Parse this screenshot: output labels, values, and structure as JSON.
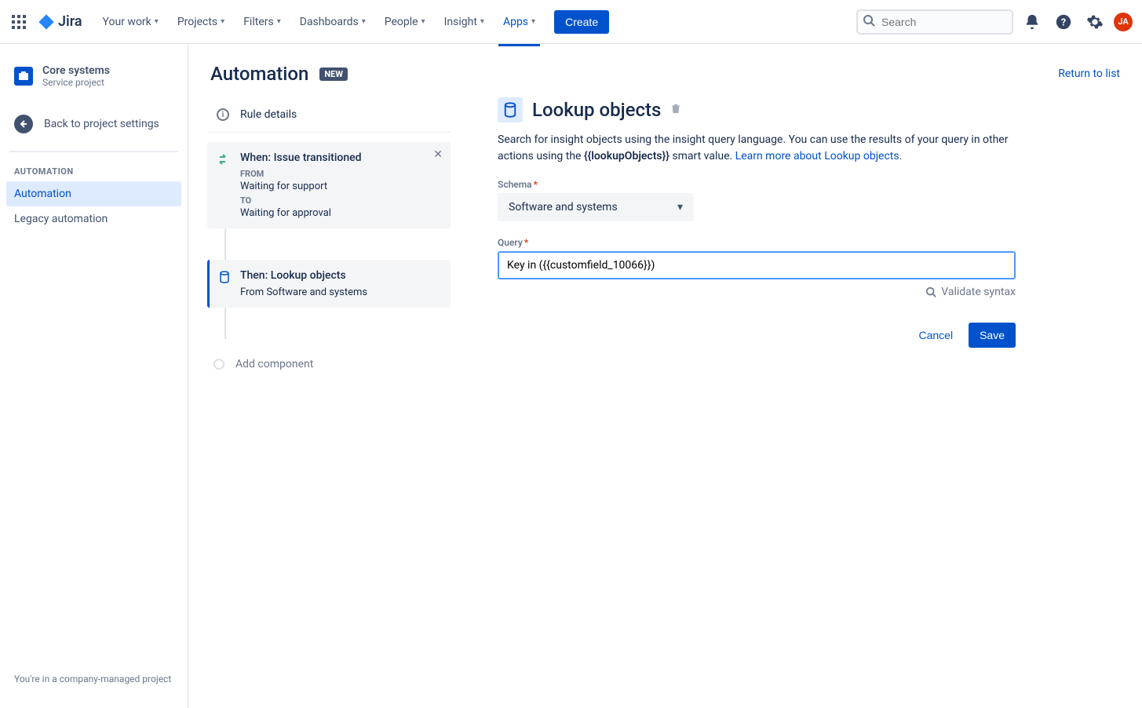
{
  "topbar": {
    "logo": "Jira",
    "nav": [
      "Your work",
      "Projects",
      "Filters",
      "Dashboards",
      "People",
      "Insight",
      "Apps"
    ],
    "active_nav": "Apps",
    "create": "Create",
    "search_placeholder": "Search",
    "avatar_initials": "JA"
  },
  "sidebar": {
    "project_name": "Core systems",
    "project_type": "Service project",
    "back_label": "Back to project settings",
    "section_label": "AUTOMATION",
    "items": [
      {
        "label": "Automation",
        "active": true
      },
      {
        "label": "Legacy automation",
        "active": false
      }
    ],
    "footer": "You're in a company-managed project"
  },
  "page": {
    "title": "Automation",
    "badge": "NEW",
    "return": "Return to list"
  },
  "rules": {
    "details_label": "Rule details",
    "trigger": {
      "title": "When: Issue transitioned",
      "from_label": "FROM",
      "from_value": "Waiting for support",
      "to_label": "TO",
      "to_value": "Waiting for approval"
    },
    "action": {
      "title": "Then: Lookup objects",
      "subtitle": "From Software and systems"
    },
    "add_component": "Add component"
  },
  "detail": {
    "title": "Lookup objects",
    "desc_pre": "Search for insight objects using the insight query language. You can use the results of your query in other actions using the ",
    "desc_smart": "{{lookupObjects}}",
    "desc_mid": " smart value. ",
    "desc_link": "Learn more about Lookup objects",
    "schema_label": "Schema",
    "schema_value": "Software and systems",
    "query_label": "Query",
    "query_value": "Key in ({{customfield_10066}})",
    "validate": "Validate syntax",
    "cancel": "Cancel",
    "save": "Save"
  }
}
